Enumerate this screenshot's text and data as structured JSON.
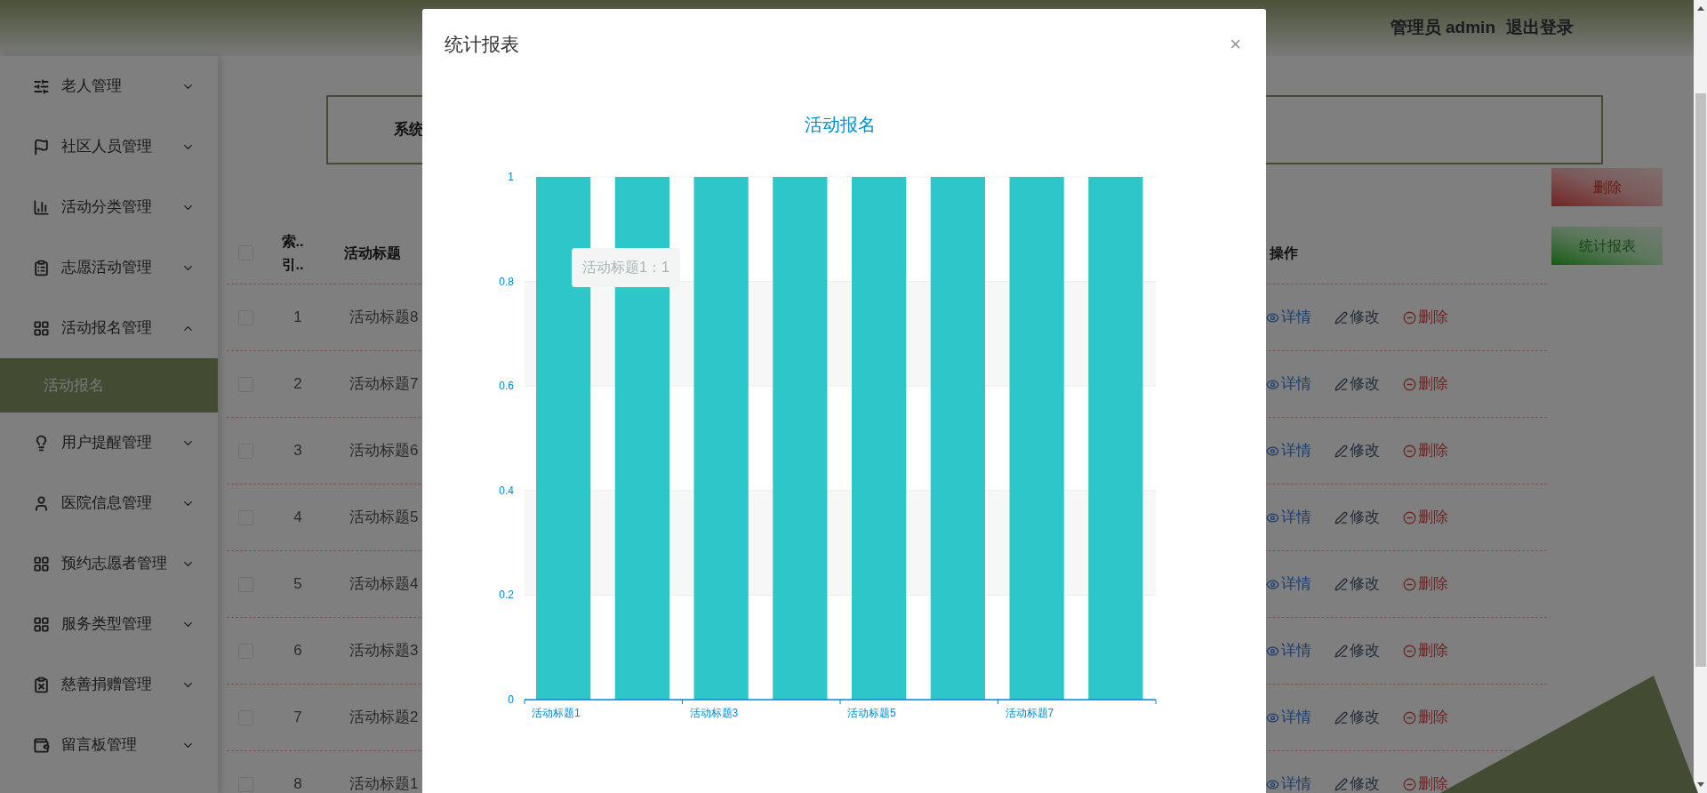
{
  "header": {
    "user": "管理员 admin",
    "logout": "退出登录"
  },
  "sidebar": {
    "items": [
      {
        "label": "老人管理",
        "expanded": false
      },
      {
        "label": "社区人员管理",
        "expanded": false
      },
      {
        "label": "活动分类管理",
        "expanded": false
      },
      {
        "label": "志愿活动管理",
        "expanded": false
      },
      {
        "label": "活动报名管理",
        "expanded": true,
        "children": [
          {
            "label": "活动报名",
            "selected": true
          }
        ]
      },
      {
        "label": "用户提醒管理",
        "expanded": false
      },
      {
        "label": "医院信息管理",
        "expanded": false
      },
      {
        "label": "预约志愿者管理",
        "expanded": false
      },
      {
        "label": "服务类型管理",
        "expanded": false
      },
      {
        "label": "慈善捐赠管理",
        "expanded": false
      },
      {
        "label": "留言板管理",
        "expanded": false
      }
    ]
  },
  "search_box": {
    "label": "系统"
  },
  "buttons": [
    "删除",
    "统计报表"
  ],
  "table": {
    "header_checked": false,
    "columns": [
      "索.. 引..",
      "活动标题",
      "操作"
    ],
    "rows": [
      {
        "checked": false,
        "index": "1",
        "title": "活动标题8",
        "actions": [
          "详情",
          "修改",
          "删除"
        ]
      },
      {
        "checked": false,
        "index": "2",
        "title": "活动标题7",
        "actions": [
          "详情",
          "修改",
          "删除"
        ]
      },
      {
        "checked": false,
        "index": "3",
        "title": "活动标题6",
        "actions": [
          "详情",
          "修改",
          "删除"
        ]
      },
      {
        "checked": false,
        "index": "4",
        "title": "活动标题5",
        "actions": [
          "详情",
          "修改",
          "删除"
        ]
      },
      {
        "checked": false,
        "index": "5",
        "title": "活动标题4",
        "actions": [
          "详情",
          "修改",
          "删除"
        ]
      },
      {
        "checked": false,
        "index": "6",
        "title": "活动标题3",
        "actions": [
          "详情",
          "修改",
          "删除"
        ]
      },
      {
        "checked": false,
        "index": "7",
        "title": "活动标题2",
        "actions": [
          "详情",
          "修改",
          "删除"
        ]
      },
      {
        "checked": false,
        "index": "8",
        "title": "活动标题1",
        "actions": [
          "详情",
          "修改",
          "删除"
        ]
      }
    ]
  },
  "modal": {
    "title": "统计报表",
    "close": "×",
    "tooltip": "活动标题1：1",
    "chart_data": {
      "type": "bar",
      "title": "活动报名",
      "categories": [
        "活动标题1",
        null,
        "活动标题3",
        null,
        "活动标题5",
        null,
        "活动标题7",
        null
      ],
      "grid": true,
      "series": [
        {
          "color": "#2ec7c9",
          "values": [
            1,
            1,
            1,
            1,
            1,
            1,
            1,
            1
          ]
        }
      ],
      "ylim": [
        0,
        1
      ],
      "yticks": [
        0,
        0.2,
        0.4,
        0.6,
        0.8,
        1
      ]
    }
  }
}
